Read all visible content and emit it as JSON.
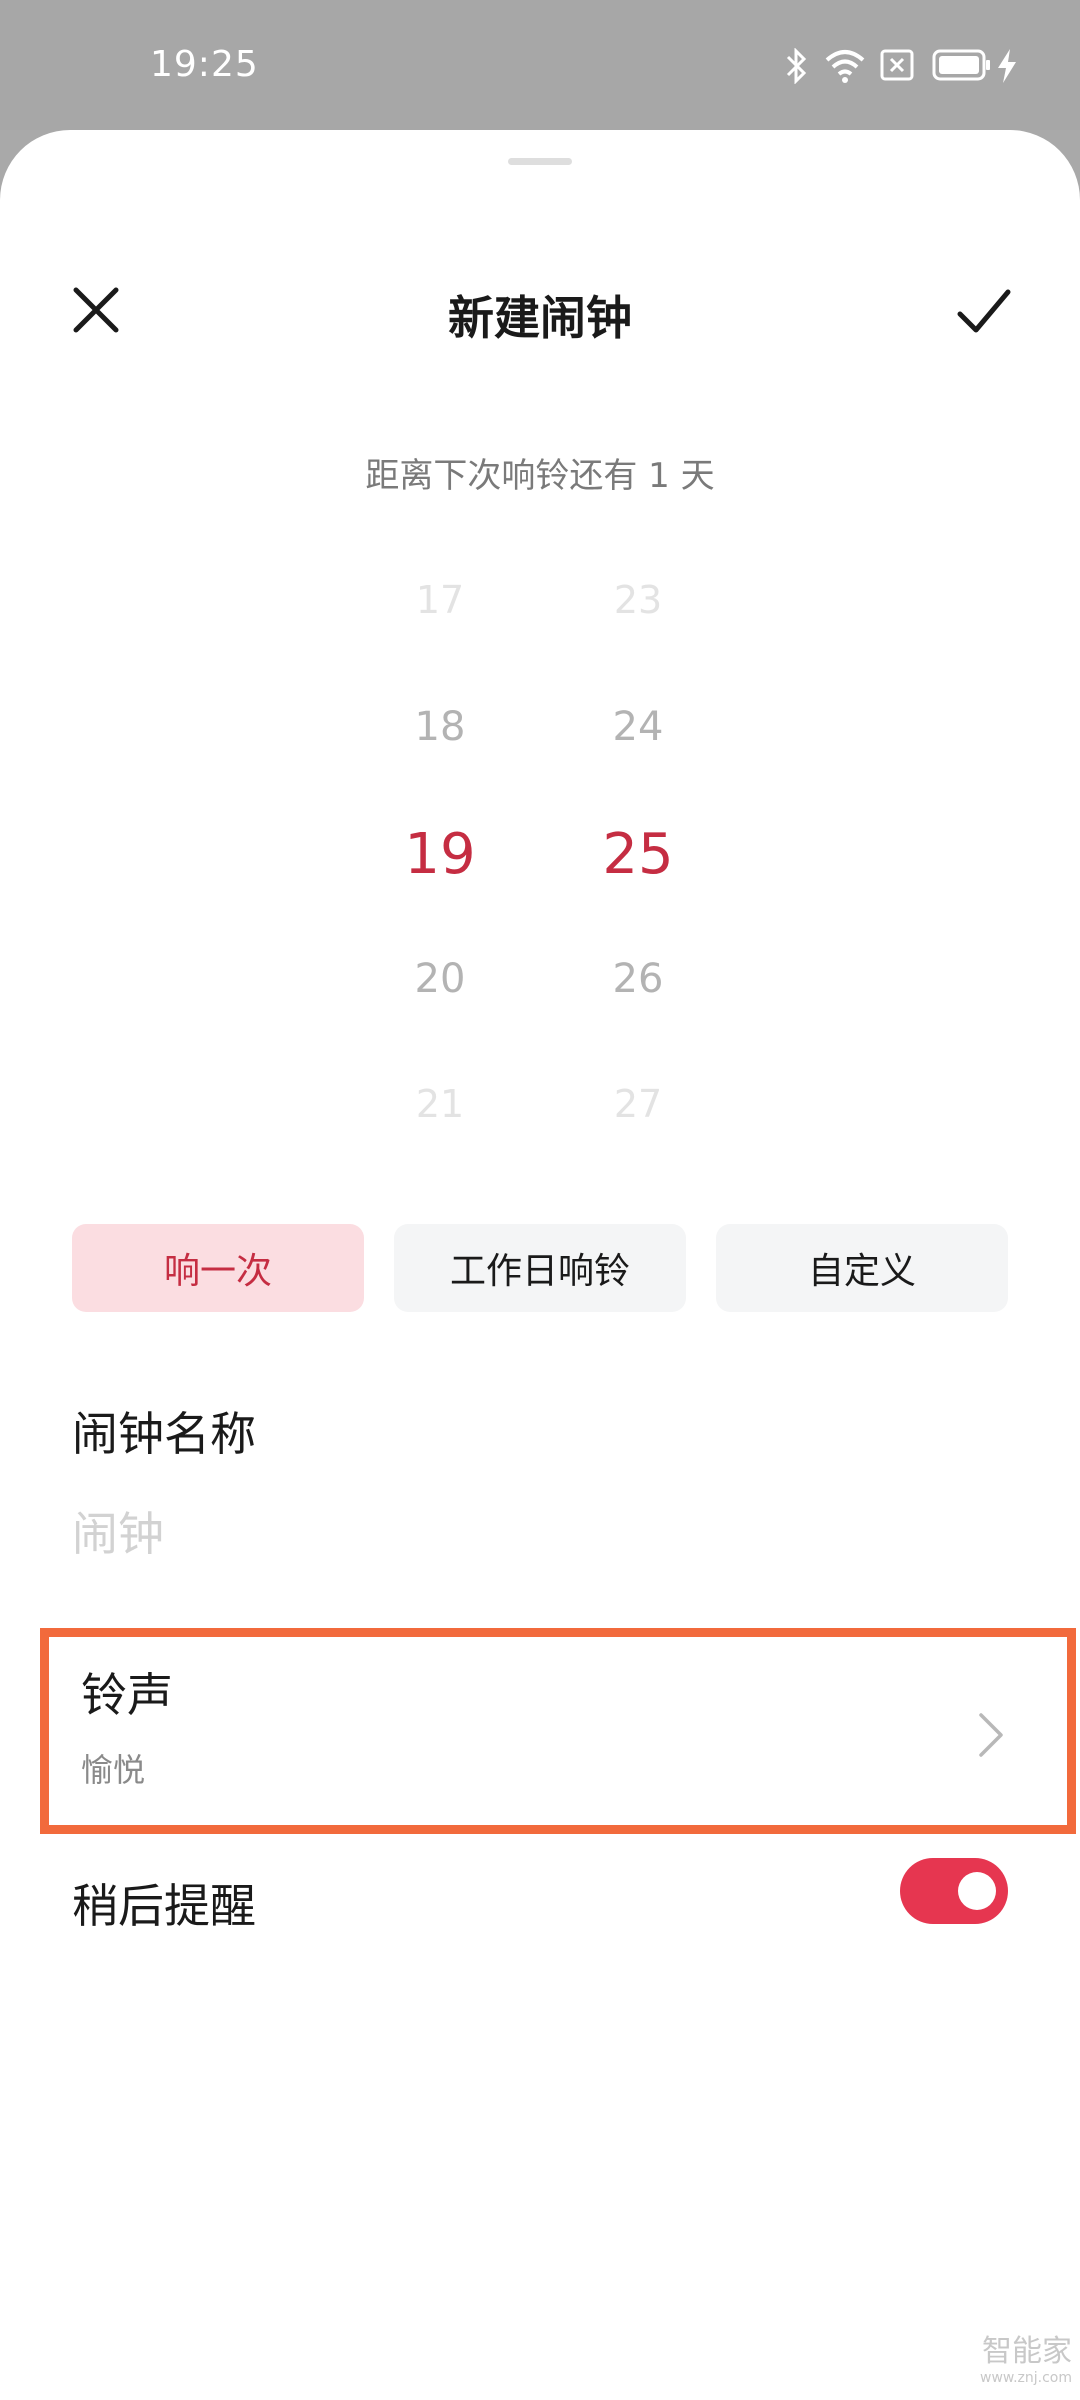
{
  "status_bar": {
    "time": "19:25",
    "icons": [
      "bluetooth-icon",
      "wifi-icon",
      "sim-off-icon",
      "battery-icon",
      "charging-icon"
    ]
  },
  "header": {
    "title": "新建闹钟",
    "close_icon": "close-icon",
    "confirm_icon": "check-icon"
  },
  "countdown": "距离下次响铃还有 1 天",
  "time_picker": {
    "hours": [
      "17",
      "18",
      "19",
      "20",
      "21"
    ],
    "minutes": [
      "23",
      "24",
      "25",
      "26",
      "27"
    ],
    "selected_hour": "19",
    "selected_minute": "25"
  },
  "repeat_options": [
    "响一次",
    "工作日响铃",
    "自定义"
  ],
  "repeat_selected": "响一次",
  "alarm_name": {
    "label": "闹钟名称",
    "placeholder": "闹钟"
  },
  "ringtone": {
    "label": "铃声",
    "value": "愉悦"
  },
  "snooze": {
    "label": "稍后提醒",
    "enabled": true
  },
  "watermark": {
    "main": "智能家",
    "sub": "www.znj.com"
  },
  "colors": {
    "accent": "#c52d42",
    "toggle_on": "#e63650",
    "highlight_border": "#f26a3c",
    "selected_chip_bg": "#fbdde1"
  }
}
